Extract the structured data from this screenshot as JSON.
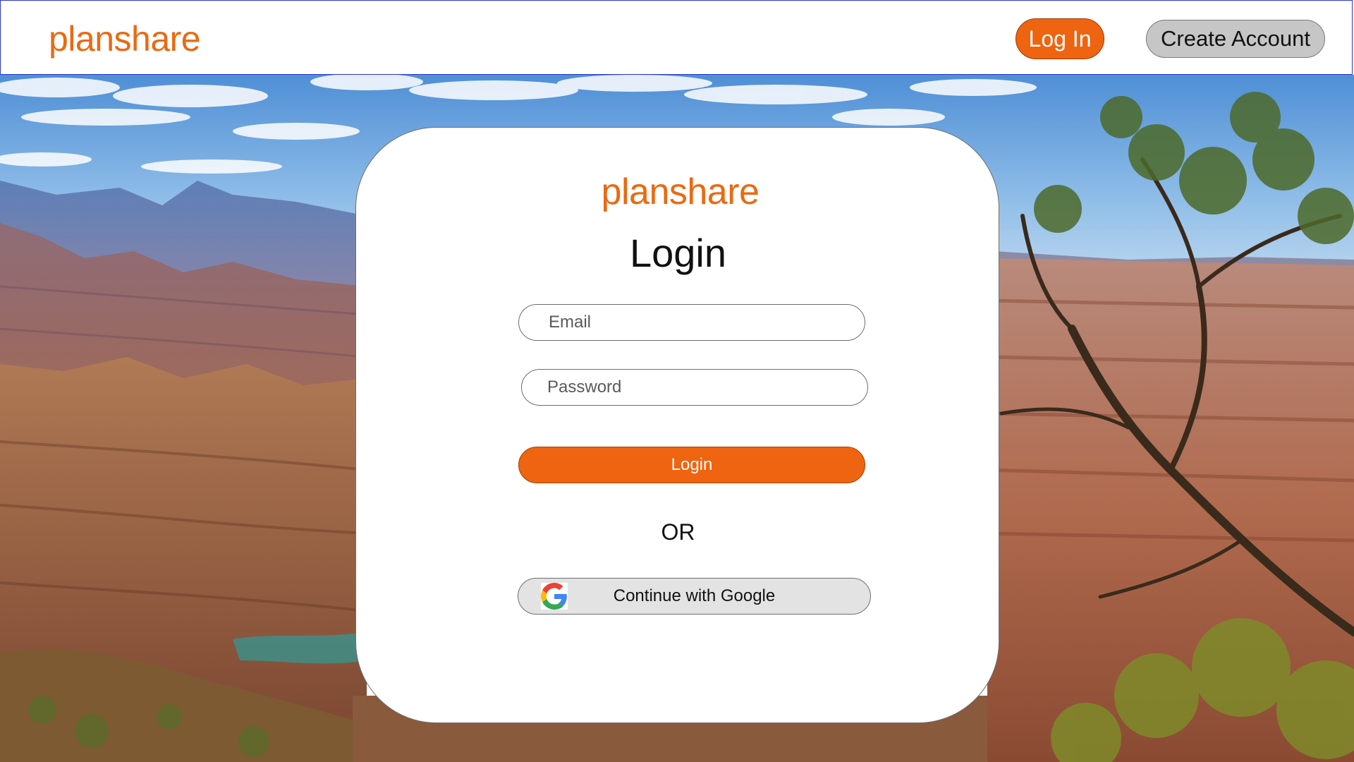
{
  "navbar": {
    "brand": "planshare",
    "login_label": "Log In",
    "create_account_label": "Create Account"
  },
  "card": {
    "brand": "planshare",
    "title": "Login",
    "email_placeholder": "Email",
    "password_placeholder": "Password",
    "login_button": "Login",
    "or_text": "OR",
    "google_button": "Continue with Google"
  },
  "icons": {
    "google": "google-logo-icon"
  },
  "colors": {
    "brand_orange": "#ea6a12",
    "button_orange": "#ee6410",
    "create_account_gray": "#c6c6c6",
    "google_button_gray": "#e3e3e3",
    "nav_border": "#2b35c8"
  }
}
